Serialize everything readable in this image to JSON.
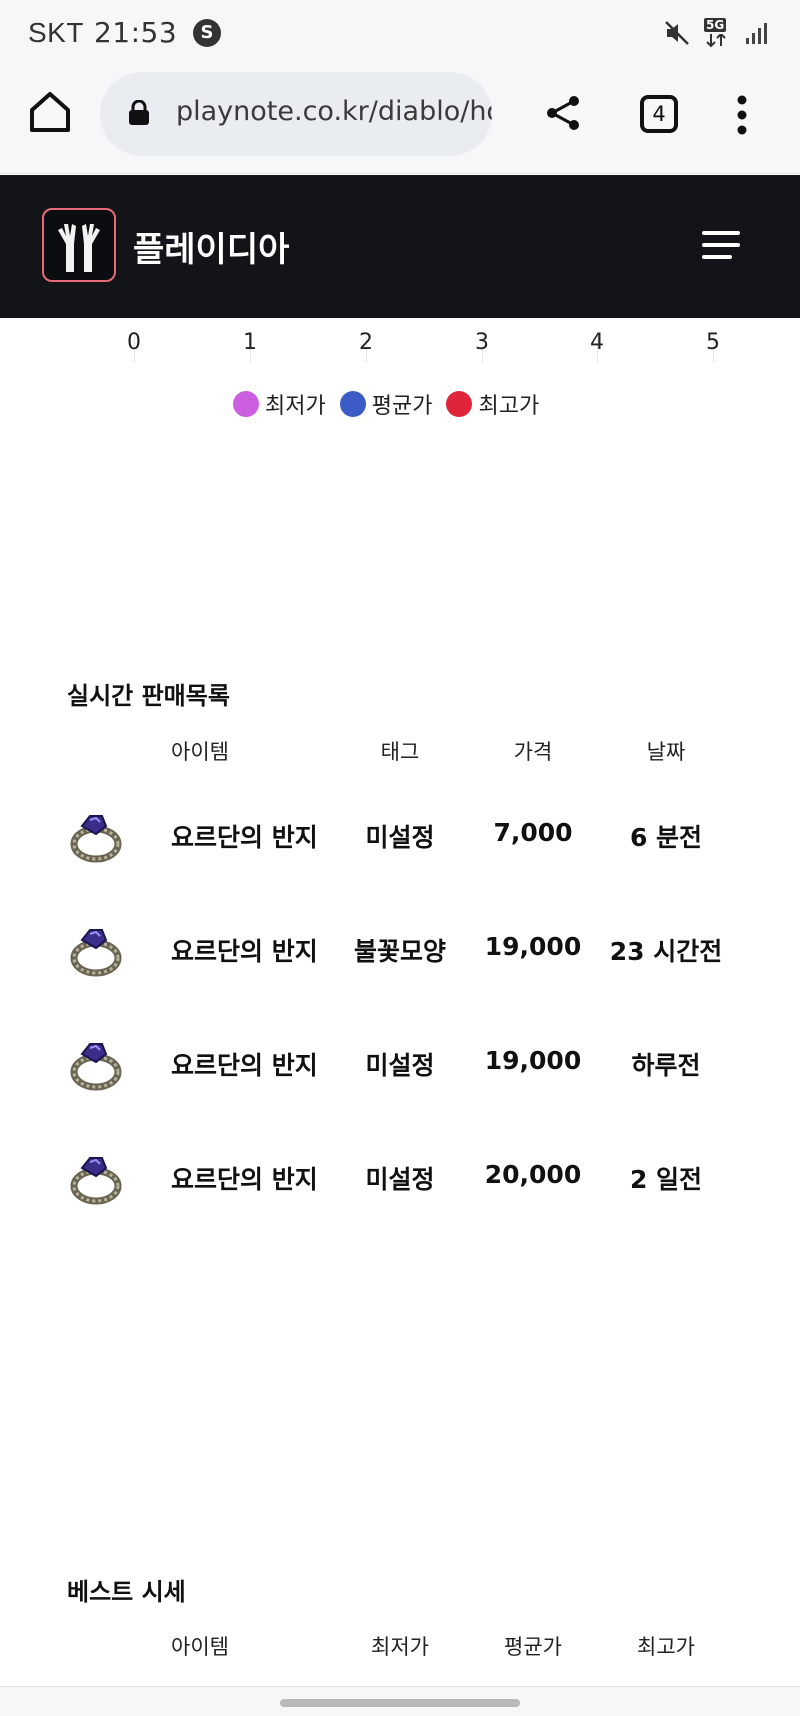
{
  "status_bar": {
    "carrier": "SKT",
    "time": "21:53",
    "network": "5G"
  },
  "browser": {
    "url": "playnote.co.kr/diablo/hor",
    "tab_count": "4"
  },
  "site": {
    "title": "플레이디아"
  },
  "chart": {
    "ticks": [
      "0",
      "1",
      "2",
      "3",
      "4",
      "5"
    ],
    "legend": [
      {
        "label": "최저가",
        "color": "#cc5ee0"
      },
      {
        "label": "평균가",
        "color": "#3b5cc6"
      },
      {
        "label": "최고가",
        "color": "#e0243a"
      }
    ]
  },
  "realtime": {
    "title": "실시간 판매목록",
    "headers": {
      "item": "아이템",
      "tag": "태그",
      "price": "가격",
      "date": "날짜"
    },
    "rows": [
      {
        "name": "요르단의 반지",
        "tag": "미설정",
        "price": "7,000",
        "date": "6 분전"
      },
      {
        "name": "요르단의 반지",
        "tag": "불꽃모양",
        "price": "19,000",
        "date": "23 시간전"
      },
      {
        "name": "요르단의 반지",
        "tag": "미설정",
        "price": "19,000",
        "date": "하루전"
      },
      {
        "name": "요르단의 반지",
        "tag": "미설정",
        "price": "20,000",
        "date": "2 일전"
      }
    ]
  },
  "best": {
    "title": "베스트 시세",
    "headers": {
      "item": "아이템",
      "min": "최저가",
      "avg": "평균가",
      "max": "최고가"
    }
  }
}
